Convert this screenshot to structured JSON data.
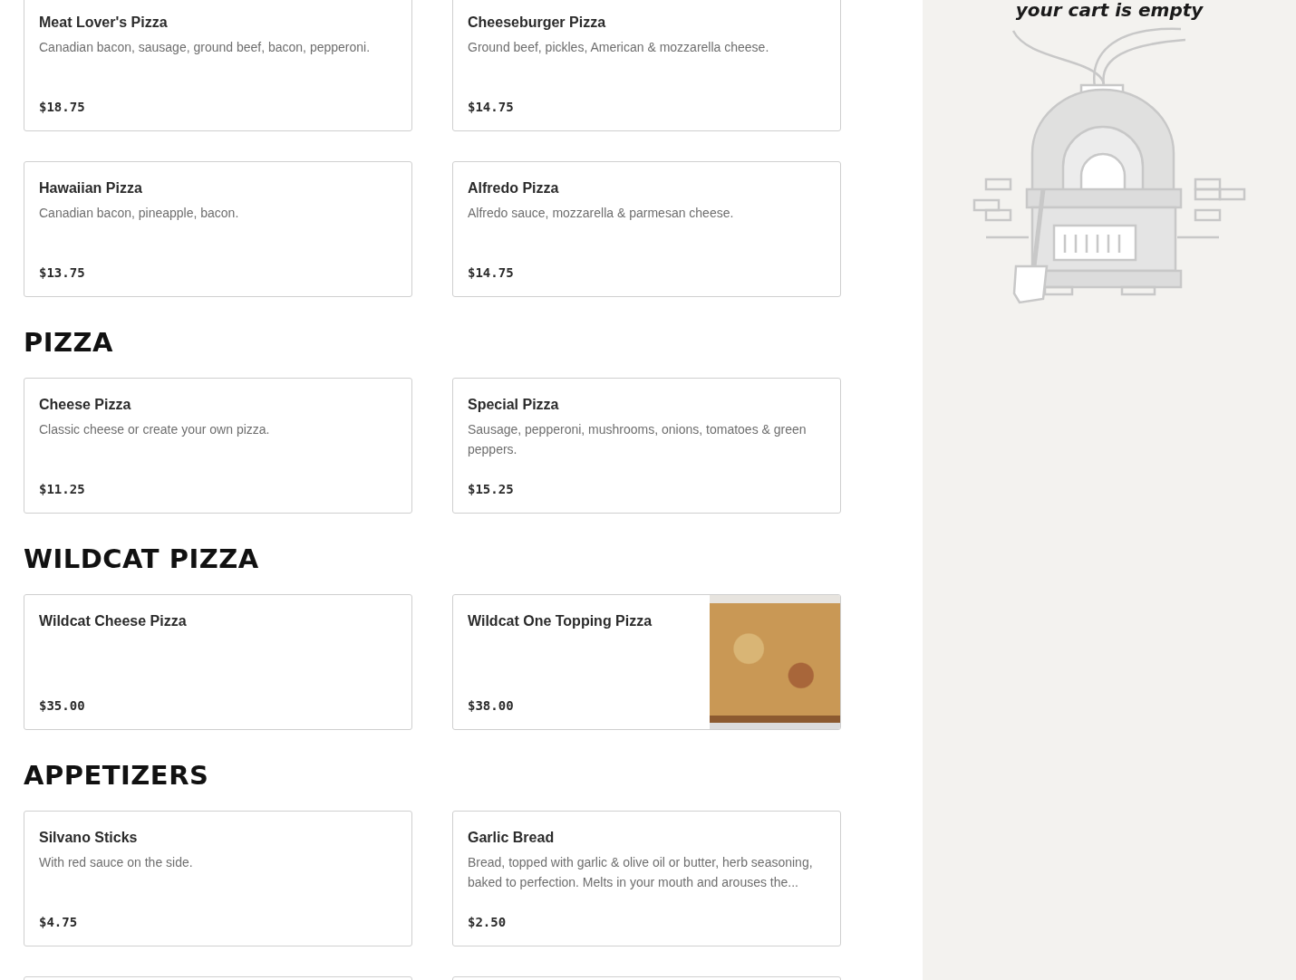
{
  "menu": {
    "sections": [
      {
        "items": [
          {
            "kind": "plain",
            "name": "Meat Lover's Pizza",
            "description": "Canadian bacon, sausage, ground beef, bacon, pepperoni.",
            "price": "$18.75"
          },
          {
            "kind": "plain",
            "name": "Cheeseburger Pizza",
            "description": "Ground beef, pickles, American & mozzarella cheese.",
            "price": "$14.75"
          },
          {
            "kind": "plain",
            "name": "Hawaiian Pizza",
            "description": "Canadian bacon, pineapple, bacon.",
            "price": "$13.75"
          },
          {
            "kind": "plain",
            "name": "Alfredo Pizza",
            "description": "Alfredo sauce, mozzarella & parmesan cheese.",
            "price": "$14.75"
          }
        ]
      },
      {
        "heading": "PIZZA",
        "items": [
          {
            "kind": "plain",
            "name": "Cheese Pizza",
            "description": "Classic cheese or create your own pizza.",
            "price": "$11.25"
          },
          {
            "kind": "plain",
            "name": "Special Pizza",
            "description": "Sausage, pepperoni, mushrooms, onions, tomatoes & green peppers.",
            "price": "$15.25"
          }
        ]
      },
      {
        "heading": "WILDCAT PIZZA",
        "items": [
          {
            "kind": "plain",
            "name": "Wildcat Cheese Pizza",
            "price": "$35.00"
          },
          {
            "kind": "photo",
            "name": "Wildcat One Topping Pizza",
            "price": "$38.00"
          }
        ]
      },
      {
        "heading": "APPETIZERS",
        "items": [
          {
            "kind": "plain",
            "name": "Silvano Sticks",
            "description": "With red sauce on the side.",
            "price": "$4.75"
          },
          {
            "kind": "plain",
            "name": "Garlic Bread",
            "description": "Bread, topped with garlic & olive oil or butter, herb seasoning, baked to perfection. Melts in your mouth and arouses the...",
            "price": "$2.50"
          }
        ]
      }
    ]
  },
  "cart": {
    "message": "your cart is empty"
  }
}
